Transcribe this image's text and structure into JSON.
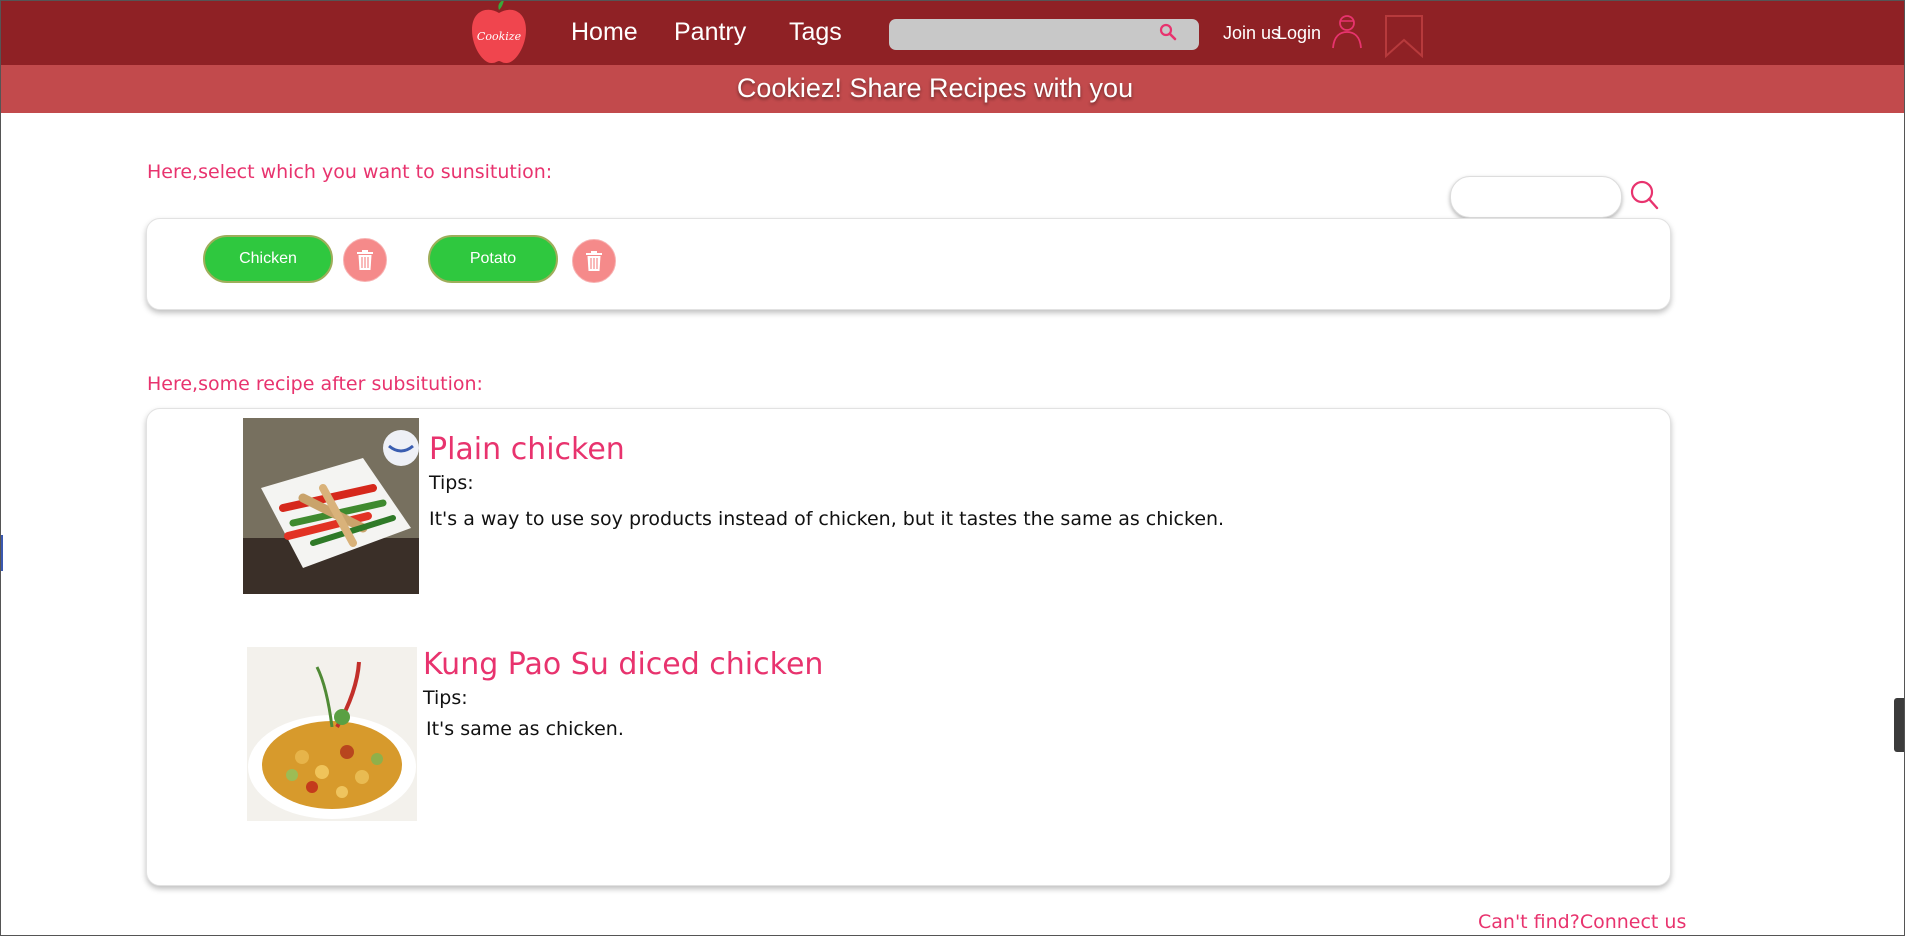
{
  "nav": {
    "logo_text": "Cookize",
    "links": [
      "Home",
      "Pantry",
      "Tags"
    ],
    "search_placeholder": "",
    "join_label": "Join us",
    "login_label": "Login"
  },
  "banner": {
    "title": "Cookiez! Share Recipes with you"
  },
  "substitution": {
    "label": "Here,select which you want to sunsitution:",
    "search_placeholder": "",
    "ingredients": [
      "Chicken",
      "Potato"
    ]
  },
  "results": {
    "label": "Here,some recipe after subsitution:",
    "recipes": [
      {
        "title": "Plain chicken",
        "tips_label": "Tips:",
        "tip": "It's a way to use soy products instead of chicken, but it tastes the same as chicken."
      },
      {
        "title": "Kung Pao Su diced chicken",
        "tips_label": "Tips:",
        "tip": "It's same as chicken."
      }
    ]
  },
  "footer": {
    "link": "Can't find?Connect us"
  },
  "colors": {
    "nav_bg": "#8f2125",
    "banner_bg": "#c24a4c",
    "accent": "#e8336e",
    "chip_bg": "#2fc83f",
    "trash_bg": "#f58a8a"
  }
}
